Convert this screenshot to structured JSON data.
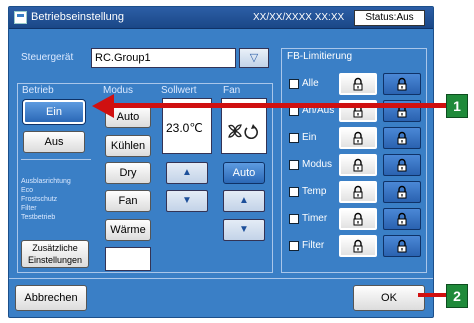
{
  "window": {
    "title": "Betriebseinstellung",
    "datetime": "XX/XX/XXXX  XX:XX",
    "status": "Status:Aus"
  },
  "steuergeraet": {
    "label": "Steuergerät",
    "value": "RC.Group1",
    "dropdown_icon": "triangle-down-icon"
  },
  "betrieb": {
    "label": "Betrieb",
    "on": "Ein",
    "off": "Aus"
  },
  "modus": {
    "label": "Modus",
    "items": [
      "Auto",
      "Kühlen",
      "Dry",
      "Fan",
      "Wärme"
    ]
  },
  "sollwert": {
    "label": "Sollwert",
    "value": "23.0℃",
    "up": "▲",
    "down": "▼"
  },
  "fan": {
    "label": "Fan",
    "auto": "Auto",
    "up": "▲",
    "down": "▼"
  },
  "info": {
    "lines": [
      "Ausblasrichtung",
      "Eco",
      "Frostschutz",
      "Filter",
      "Testbetrieb"
    ],
    "extra_button": "Zusätzliche Einstellungen"
  },
  "fb_limitierung": {
    "label": "FB-Limitierung",
    "rows": [
      {
        "label": "Alle",
        "icon": "all-icon"
      },
      {
        "label": "An/Aus",
        "icon": "onoff-icon"
      },
      {
        "label": "Ein",
        "icon": "power-icon"
      },
      {
        "label": "Modus",
        "icon": "mode-icon"
      },
      {
        "label": "Temp",
        "icon": "thermometer-icon"
      },
      {
        "label": "Timer",
        "icon": "clock-icon"
      },
      {
        "label": "Filter",
        "icon": "filter-icon"
      }
    ]
  },
  "footer": {
    "cancel": "Abbrechen",
    "ok": "OK"
  },
  "callouts": {
    "one": "1",
    "two": "2"
  },
  "colors": {
    "dialog_bg": "#3a7fc6",
    "callout_green": "#1f8a3a",
    "arrow_red": "#d01010"
  }
}
